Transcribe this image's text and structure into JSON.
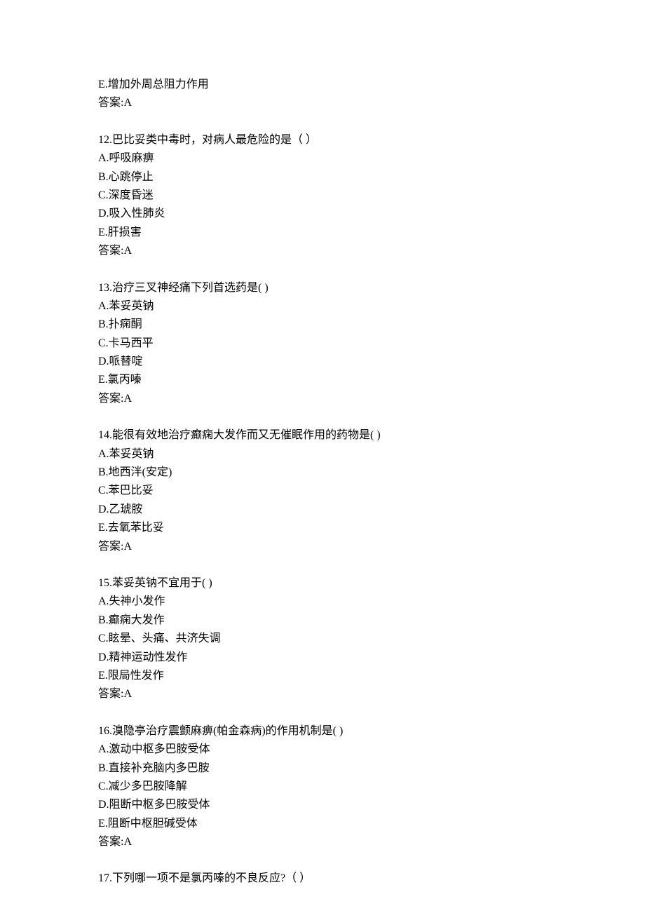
{
  "partial_top": {
    "option_e": "E.增加外周总阻力作用",
    "answer": "答案:A"
  },
  "questions": [
    {
      "stem": "12.巴比妥类中毒时，对病人最危险的是（ ）",
      "options": [
        "A.呼吸麻痹",
        "B.心跳停止",
        "C.深度昏迷",
        "D.吸入性肺炎",
        "E.肝损害"
      ],
      "answer": "答案:A"
    },
    {
      "stem": "13.治疗三叉神经痛下列首选药是( )",
      "options": [
        "A.苯妥英钠",
        "B.扑痫酮",
        "C.卡马西平",
        "D.哌替啶",
        "E.氯丙嗪"
      ],
      "answer": "答案:A"
    },
    {
      "stem": "14.能很有效地治疗癫痫大发作而又无催眠作用的药物是( )",
      "options": [
        "A.苯妥英钠",
        "B.地西泮(安定)",
        "C.苯巴比妥",
        "D.乙琥胺",
        "E.去氧苯比妥"
      ],
      "answer": "答案:A"
    },
    {
      "stem": "15.苯妥英钠不宜用于( )",
      "options": [
        "A.失神小发作",
        "B.癫痫大发作",
        "C.眩晕、头痛、共济失调",
        "D.精神运动性发作",
        "E.限局性发作"
      ],
      "answer": "答案:A"
    },
    {
      "stem": "16.溴隐亭治疗震颤麻痹(帕金森病)的作用机制是( )",
      "options": [
        "A.激动中枢多巴胺受体",
        "B.直接补充脑内多巴胺",
        "C.减少多巴胺降解",
        "D.阻断中枢多巴胺受体",
        "E.阻断中枢胆碱受体"
      ],
      "answer": "答案:A"
    }
  ],
  "partial_bottom": {
    "stem": "17.下列哪一项不是氯丙嗪的不良反应?（ ）"
  }
}
